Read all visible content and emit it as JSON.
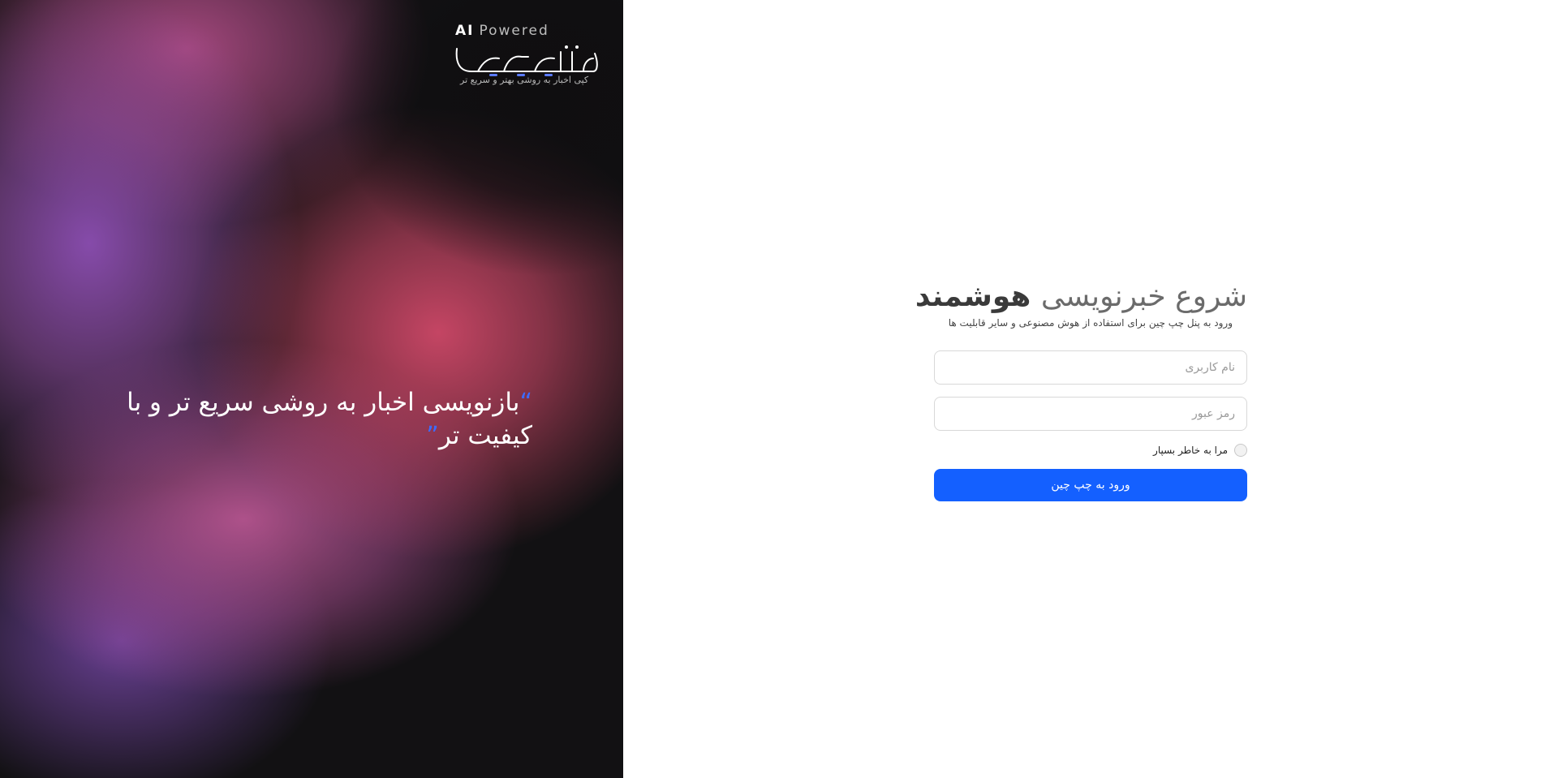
{
  "brand": {
    "ai_label": "AI",
    "powered_label": "Powered",
    "logo_text": "چیچین",
    "tagline": "کپی اخبار به روشی بهتر و سریع تر"
  },
  "hero": {
    "quote_open": "“",
    "quote_text": "بازنویسی اخبار به روشی سریع تر و با کیفیت تر",
    "quote_close": "”"
  },
  "login": {
    "title_light": "شروع خبرنویسی",
    "title_bold": "هوشمند",
    "subtitle": "ورود به پنل چپ چین برای استفاده از هوش مصنوعی و سایر قابلیت ها",
    "username_placeholder": "نام کاربری",
    "password_placeholder": "رمز عبور",
    "remember_label": "مرا به خاطر بسپار",
    "submit_label": "ورود به چپ چین"
  },
  "colors": {
    "accent": "#1460ff",
    "quote_mark": "#3d6bff",
    "hero_dark": "#121113"
  }
}
